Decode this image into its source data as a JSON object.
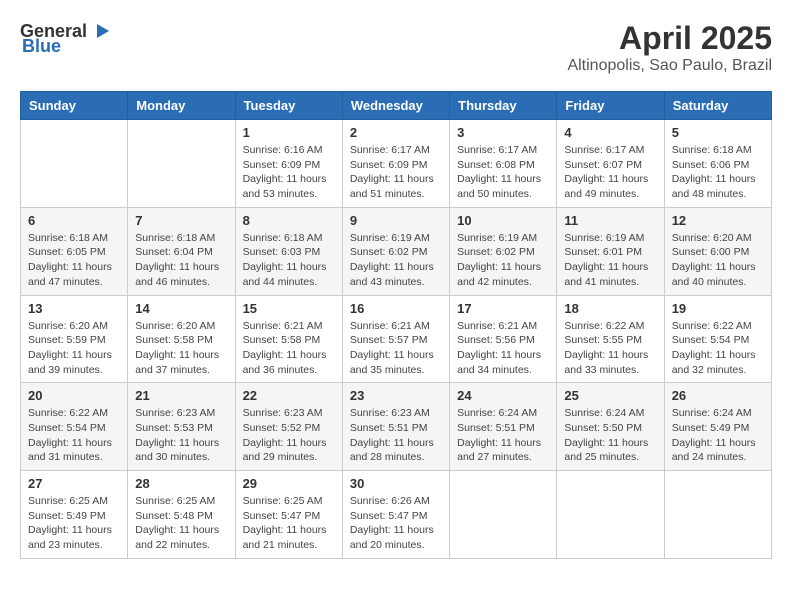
{
  "logo": {
    "general": "General",
    "blue": "Blue"
  },
  "title": {
    "month_year": "April 2025",
    "location": "Altinopolis, Sao Paulo, Brazil"
  },
  "weekdays": [
    "Sunday",
    "Monday",
    "Tuesday",
    "Wednesday",
    "Thursday",
    "Friday",
    "Saturday"
  ],
  "weeks": [
    [
      {
        "day": "",
        "info": ""
      },
      {
        "day": "",
        "info": ""
      },
      {
        "day": "1",
        "info": "Sunrise: 6:16 AM\nSunset: 6:09 PM\nDaylight: 11 hours and 53 minutes."
      },
      {
        "day": "2",
        "info": "Sunrise: 6:17 AM\nSunset: 6:09 PM\nDaylight: 11 hours and 51 minutes."
      },
      {
        "day": "3",
        "info": "Sunrise: 6:17 AM\nSunset: 6:08 PM\nDaylight: 11 hours and 50 minutes."
      },
      {
        "day": "4",
        "info": "Sunrise: 6:17 AM\nSunset: 6:07 PM\nDaylight: 11 hours and 49 minutes."
      },
      {
        "day": "5",
        "info": "Sunrise: 6:18 AM\nSunset: 6:06 PM\nDaylight: 11 hours and 48 minutes."
      }
    ],
    [
      {
        "day": "6",
        "info": "Sunrise: 6:18 AM\nSunset: 6:05 PM\nDaylight: 11 hours and 47 minutes."
      },
      {
        "day": "7",
        "info": "Sunrise: 6:18 AM\nSunset: 6:04 PM\nDaylight: 11 hours and 46 minutes."
      },
      {
        "day": "8",
        "info": "Sunrise: 6:18 AM\nSunset: 6:03 PM\nDaylight: 11 hours and 44 minutes."
      },
      {
        "day": "9",
        "info": "Sunrise: 6:19 AM\nSunset: 6:02 PM\nDaylight: 11 hours and 43 minutes."
      },
      {
        "day": "10",
        "info": "Sunrise: 6:19 AM\nSunset: 6:02 PM\nDaylight: 11 hours and 42 minutes."
      },
      {
        "day": "11",
        "info": "Sunrise: 6:19 AM\nSunset: 6:01 PM\nDaylight: 11 hours and 41 minutes."
      },
      {
        "day": "12",
        "info": "Sunrise: 6:20 AM\nSunset: 6:00 PM\nDaylight: 11 hours and 40 minutes."
      }
    ],
    [
      {
        "day": "13",
        "info": "Sunrise: 6:20 AM\nSunset: 5:59 PM\nDaylight: 11 hours and 39 minutes."
      },
      {
        "day": "14",
        "info": "Sunrise: 6:20 AM\nSunset: 5:58 PM\nDaylight: 11 hours and 37 minutes."
      },
      {
        "day": "15",
        "info": "Sunrise: 6:21 AM\nSunset: 5:58 PM\nDaylight: 11 hours and 36 minutes."
      },
      {
        "day": "16",
        "info": "Sunrise: 6:21 AM\nSunset: 5:57 PM\nDaylight: 11 hours and 35 minutes."
      },
      {
        "day": "17",
        "info": "Sunrise: 6:21 AM\nSunset: 5:56 PM\nDaylight: 11 hours and 34 minutes."
      },
      {
        "day": "18",
        "info": "Sunrise: 6:22 AM\nSunset: 5:55 PM\nDaylight: 11 hours and 33 minutes."
      },
      {
        "day": "19",
        "info": "Sunrise: 6:22 AM\nSunset: 5:54 PM\nDaylight: 11 hours and 32 minutes."
      }
    ],
    [
      {
        "day": "20",
        "info": "Sunrise: 6:22 AM\nSunset: 5:54 PM\nDaylight: 11 hours and 31 minutes."
      },
      {
        "day": "21",
        "info": "Sunrise: 6:23 AM\nSunset: 5:53 PM\nDaylight: 11 hours and 30 minutes."
      },
      {
        "day": "22",
        "info": "Sunrise: 6:23 AM\nSunset: 5:52 PM\nDaylight: 11 hours and 29 minutes."
      },
      {
        "day": "23",
        "info": "Sunrise: 6:23 AM\nSunset: 5:51 PM\nDaylight: 11 hours and 28 minutes."
      },
      {
        "day": "24",
        "info": "Sunrise: 6:24 AM\nSunset: 5:51 PM\nDaylight: 11 hours and 27 minutes."
      },
      {
        "day": "25",
        "info": "Sunrise: 6:24 AM\nSunset: 5:50 PM\nDaylight: 11 hours and 25 minutes."
      },
      {
        "day": "26",
        "info": "Sunrise: 6:24 AM\nSunset: 5:49 PM\nDaylight: 11 hours and 24 minutes."
      }
    ],
    [
      {
        "day": "27",
        "info": "Sunrise: 6:25 AM\nSunset: 5:49 PM\nDaylight: 11 hours and 23 minutes."
      },
      {
        "day": "28",
        "info": "Sunrise: 6:25 AM\nSunset: 5:48 PM\nDaylight: 11 hours and 22 minutes."
      },
      {
        "day": "29",
        "info": "Sunrise: 6:25 AM\nSunset: 5:47 PM\nDaylight: 11 hours and 21 minutes."
      },
      {
        "day": "30",
        "info": "Sunrise: 6:26 AM\nSunset: 5:47 PM\nDaylight: 11 hours and 20 minutes."
      },
      {
        "day": "",
        "info": ""
      },
      {
        "day": "",
        "info": ""
      },
      {
        "day": "",
        "info": ""
      }
    ]
  ]
}
